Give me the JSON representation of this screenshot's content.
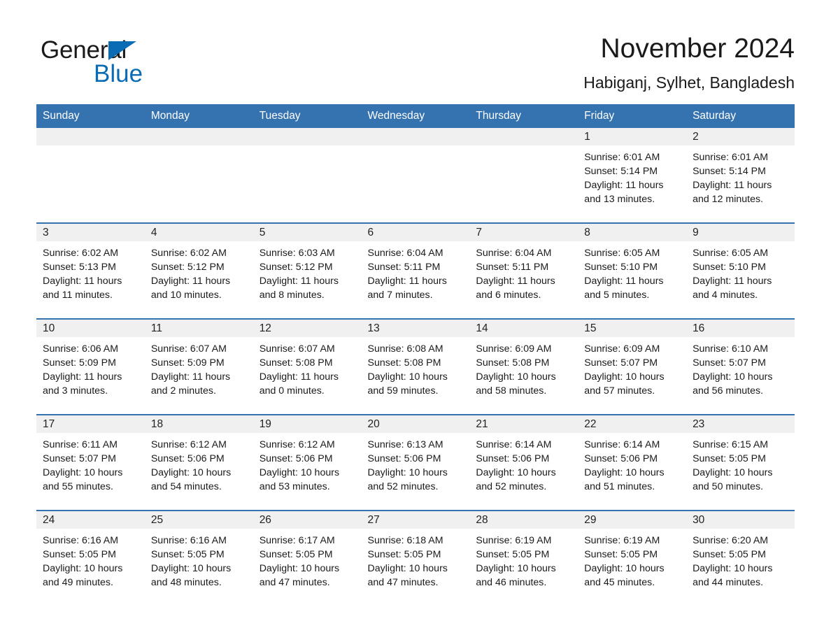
{
  "logo": {
    "word_one": "General",
    "word_two": "Blue",
    "triangle_color": "#0a6cb4",
    "blue_color": "#0a6cb4"
  },
  "header": {
    "month_title": "November 2024",
    "location": "Habiganj, Sylhet, Bangladesh",
    "accent_color": "#3572b0",
    "band_color": "#f0f0f0"
  },
  "calendar": {
    "weekday_headers": [
      "Sunday",
      "Monday",
      "Tuesday",
      "Wednesday",
      "Thursday",
      "Friday",
      "Saturday"
    ],
    "weeks": [
      [
        {
          "day": "",
          "sunrise": "",
          "sunset": "",
          "daylight": "",
          "empty": true
        },
        {
          "day": "",
          "sunrise": "",
          "sunset": "",
          "daylight": "",
          "empty": true
        },
        {
          "day": "",
          "sunrise": "",
          "sunset": "",
          "daylight": "",
          "empty": true
        },
        {
          "day": "",
          "sunrise": "",
          "sunset": "",
          "daylight": "",
          "empty": true
        },
        {
          "day": "",
          "sunrise": "",
          "sunset": "",
          "daylight": "",
          "empty": true
        },
        {
          "day": "1",
          "sunrise": "Sunrise: 6:01 AM",
          "sunset": "Sunset: 5:14 PM",
          "daylight": "Daylight: 11 hours and 13 minutes.",
          "empty": false
        },
        {
          "day": "2",
          "sunrise": "Sunrise: 6:01 AM",
          "sunset": "Sunset: 5:14 PM",
          "daylight": "Daylight: 11 hours and 12 minutes.",
          "empty": false
        }
      ],
      [
        {
          "day": "3",
          "sunrise": "Sunrise: 6:02 AM",
          "sunset": "Sunset: 5:13 PM",
          "daylight": "Daylight: 11 hours and 11 minutes.",
          "empty": false
        },
        {
          "day": "4",
          "sunrise": "Sunrise: 6:02 AM",
          "sunset": "Sunset: 5:12 PM",
          "daylight": "Daylight: 11 hours and 10 minutes.",
          "empty": false
        },
        {
          "day": "5",
          "sunrise": "Sunrise: 6:03 AM",
          "sunset": "Sunset: 5:12 PM",
          "daylight": "Daylight: 11 hours and 8 minutes.",
          "empty": false
        },
        {
          "day": "6",
          "sunrise": "Sunrise: 6:04 AM",
          "sunset": "Sunset: 5:11 PM",
          "daylight": "Daylight: 11 hours and 7 minutes.",
          "empty": false
        },
        {
          "day": "7",
          "sunrise": "Sunrise: 6:04 AM",
          "sunset": "Sunset: 5:11 PM",
          "daylight": "Daylight: 11 hours and 6 minutes.",
          "empty": false
        },
        {
          "day": "8",
          "sunrise": "Sunrise: 6:05 AM",
          "sunset": "Sunset: 5:10 PM",
          "daylight": "Daylight: 11 hours and 5 minutes.",
          "empty": false
        },
        {
          "day": "9",
          "sunrise": "Sunrise: 6:05 AM",
          "sunset": "Sunset: 5:10 PM",
          "daylight": "Daylight: 11 hours and 4 minutes.",
          "empty": false
        }
      ],
      [
        {
          "day": "10",
          "sunrise": "Sunrise: 6:06 AM",
          "sunset": "Sunset: 5:09 PM",
          "daylight": "Daylight: 11 hours and 3 minutes.",
          "empty": false
        },
        {
          "day": "11",
          "sunrise": "Sunrise: 6:07 AM",
          "sunset": "Sunset: 5:09 PM",
          "daylight": "Daylight: 11 hours and 2 minutes.",
          "empty": false
        },
        {
          "day": "12",
          "sunrise": "Sunrise: 6:07 AM",
          "sunset": "Sunset: 5:08 PM",
          "daylight": "Daylight: 11 hours and 0 minutes.",
          "empty": false
        },
        {
          "day": "13",
          "sunrise": "Sunrise: 6:08 AM",
          "sunset": "Sunset: 5:08 PM",
          "daylight": "Daylight: 10 hours and 59 minutes.",
          "empty": false
        },
        {
          "day": "14",
          "sunrise": "Sunrise: 6:09 AM",
          "sunset": "Sunset: 5:08 PM",
          "daylight": "Daylight: 10 hours and 58 minutes.",
          "empty": false
        },
        {
          "day": "15",
          "sunrise": "Sunrise: 6:09 AM",
          "sunset": "Sunset: 5:07 PM",
          "daylight": "Daylight: 10 hours and 57 minutes.",
          "empty": false
        },
        {
          "day": "16",
          "sunrise": "Sunrise: 6:10 AM",
          "sunset": "Sunset: 5:07 PM",
          "daylight": "Daylight: 10 hours and 56 minutes.",
          "empty": false
        }
      ],
      [
        {
          "day": "17",
          "sunrise": "Sunrise: 6:11 AM",
          "sunset": "Sunset: 5:07 PM",
          "daylight": "Daylight: 10 hours and 55 minutes.",
          "empty": false
        },
        {
          "day": "18",
          "sunrise": "Sunrise: 6:12 AM",
          "sunset": "Sunset: 5:06 PM",
          "daylight": "Daylight: 10 hours and 54 minutes.",
          "empty": false
        },
        {
          "day": "19",
          "sunrise": "Sunrise: 6:12 AM",
          "sunset": "Sunset: 5:06 PM",
          "daylight": "Daylight: 10 hours and 53 minutes.",
          "empty": false
        },
        {
          "day": "20",
          "sunrise": "Sunrise: 6:13 AM",
          "sunset": "Sunset: 5:06 PM",
          "daylight": "Daylight: 10 hours and 52 minutes.",
          "empty": false
        },
        {
          "day": "21",
          "sunrise": "Sunrise: 6:14 AM",
          "sunset": "Sunset: 5:06 PM",
          "daylight": "Daylight: 10 hours and 52 minutes.",
          "empty": false
        },
        {
          "day": "22",
          "sunrise": "Sunrise: 6:14 AM",
          "sunset": "Sunset: 5:06 PM",
          "daylight": "Daylight: 10 hours and 51 minutes.",
          "empty": false
        },
        {
          "day": "23",
          "sunrise": "Sunrise: 6:15 AM",
          "sunset": "Sunset: 5:05 PM",
          "daylight": "Daylight: 10 hours and 50 minutes.",
          "empty": false
        }
      ],
      [
        {
          "day": "24",
          "sunrise": "Sunrise: 6:16 AM",
          "sunset": "Sunset: 5:05 PM",
          "daylight": "Daylight: 10 hours and 49 minutes.",
          "empty": false
        },
        {
          "day": "25",
          "sunrise": "Sunrise: 6:16 AM",
          "sunset": "Sunset: 5:05 PM",
          "daylight": "Daylight: 10 hours and 48 minutes.",
          "empty": false
        },
        {
          "day": "26",
          "sunrise": "Sunrise: 6:17 AM",
          "sunset": "Sunset: 5:05 PM",
          "daylight": "Daylight: 10 hours and 47 minutes.",
          "empty": false
        },
        {
          "day": "27",
          "sunrise": "Sunrise: 6:18 AM",
          "sunset": "Sunset: 5:05 PM",
          "daylight": "Daylight: 10 hours and 47 minutes.",
          "empty": false
        },
        {
          "day": "28",
          "sunrise": "Sunrise: 6:19 AM",
          "sunset": "Sunset: 5:05 PM",
          "daylight": "Daylight: 10 hours and 46 minutes.",
          "empty": false
        },
        {
          "day": "29",
          "sunrise": "Sunrise: 6:19 AM",
          "sunset": "Sunset: 5:05 PM",
          "daylight": "Daylight: 10 hours and 45 minutes.",
          "empty": false
        },
        {
          "day": "30",
          "sunrise": "Sunrise: 6:20 AM",
          "sunset": "Sunset: 5:05 PM",
          "daylight": "Daylight: 10 hours and 44 minutes.",
          "empty": false
        }
      ]
    ]
  }
}
